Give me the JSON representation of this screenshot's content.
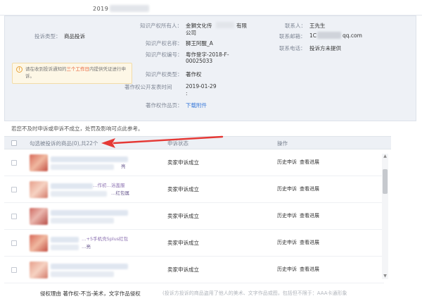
{
  "header": {
    "complaint_id_prefix": "2019"
  },
  "panel": {
    "product_type": {
      "label": "投诉类型：",
      "value": "商品投诉"
    },
    "notice": {
      "icon": "info-icon",
      "before": "请在收到投诉通知的",
      "highlight": "三个工作日",
      "after": "内提供凭证进行申诉。"
    },
    "ip_owner": {
      "label": "知识产权所有人：",
      "line1": "金獅文化传",
      "line1_tail": "有限",
      "line2": "公司"
    },
    "ip_name": {
      "label": "知识产权名称：",
      "value": "狮王阿醒_A"
    },
    "ip_number": {
      "label": "知识产权编号：",
      "line1": "粤作登字-2018-F-",
      "line2": "00025033"
    },
    "ip_type": {
      "label": "知识产权类型：",
      "value": "著作权"
    },
    "publish_date": {
      "label": "著作权公开发表时间",
      "colon": ":",
      "value": "2019-01-29"
    },
    "work_page": {
      "label": "著作权作品页：",
      "link": "下载附件"
    },
    "contact": {
      "label": "联系人：",
      "value": "王先生"
    },
    "email": {
      "label": "联系邮箱：",
      "prefix": "1C",
      "suffix": "qq.com"
    },
    "phone": {
      "label": "联系电话：",
      "value": "投诉方未提供"
    }
  },
  "warning_text": "若您不及时申诉或申诉不成立，处罚及影响可点此参考。",
  "table": {
    "header": {
      "goods": "勾选被投诉的商品(0),共22个",
      "result": "申诉状态",
      "operation": "操作"
    },
    "rows": [
      {
        "name_line1": "",
        "name_line2": "亮",
        "result": "卖家申诉成立",
        "op1": "历史申诉",
        "op2": "查看进展"
      },
      {
        "name_line1": "…作初…浴盖服",
        "name_line2": "…红包属",
        "result": "卖家申诉成立",
        "op1": "历史申诉",
        "op2": "查看进展"
      },
      {
        "name_line1": "",
        "name_line2": "",
        "result": "卖家申诉成立",
        "op1": "历史申诉",
        "op2": "查看进展"
      },
      {
        "name_line1": "…+5手机壳5plus红包",
        "name_line2": "…亮",
        "result": "卖家申诉成立",
        "op1": "历史申诉",
        "op2": "查看进展"
      },
      {
        "name_line1": "",
        "name_line2": "",
        "result": "卖家申诉成立",
        "op1": "历史申诉",
        "op2": "查看进展"
      }
    ]
  },
  "footer": {
    "text": "侵权理由   著作权-不当-美术，文字作品侵权",
    "gray": "(投诉方投诉的商品盗用了他人的美术、文字作品或图，包括但不限于：AAA卡通形象"
  },
  "colors": {
    "accent": "#3a7ad9",
    "arrow": "#e53935",
    "highlight": "#e6572c",
    "panel_bg": "#eef1f6"
  }
}
